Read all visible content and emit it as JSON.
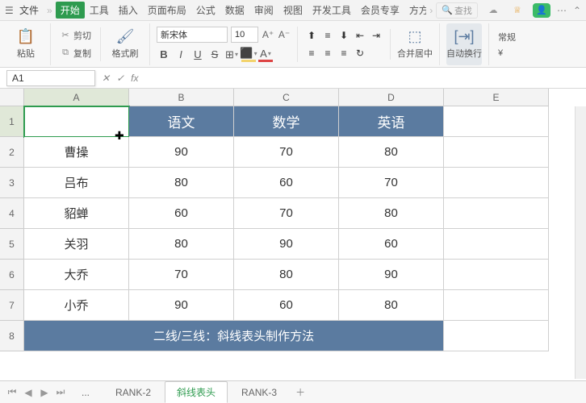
{
  "titlebar": {
    "file": "文件",
    "tabs": [
      "开始",
      "工具",
      "插入",
      "页面布局",
      "公式",
      "数据",
      "审阅",
      "视图",
      "开发工具",
      "会员专享",
      "方方格子"
    ],
    "search_placeholder": "查找"
  },
  "ribbon": {
    "paste": "粘贴",
    "cut": "剪切",
    "copy": "复制",
    "format_painter": "格式刷",
    "font_name": "新宋体",
    "font_size": "10",
    "merge": "合并居中",
    "wrap": "自动换行",
    "format": "常规"
  },
  "namebox": "A1",
  "columns": [
    "A",
    "B",
    "C",
    "D",
    "E"
  ],
  "rows": [
    "1",
    "2",
    "3",
    "4",
    "5",
    "6",
    "7",
    "8"
  ],
  "chart_data": {
    "type": "table",
    "header": [
      "",
      "语文",
      "数学",
      "英语"
    ],
    "body": [
      [
        "曹操",
        "90",
        "70",
        "80"
      ],
      [
        "吕布",
        "80",
        "60",
        "70"
      ],
      [
        "貂蝉",
        "60",
        "70",
        "80"
      ],
      [
        "关羽",
        "80",
        "90",
        "60"
      ],
      [
        "大乔",
        "70",
        "80",
        "90"
      ],
      [
        "小乔",
        "90",
        "60",
        "80"
      ]
    ],
    "footer": "二线/三线：斜线表头制作方法"
  },
  "sheets": {
    "items": [
      "...",
      "RANK-2",
      "斜线表头",
      "RANK-3"
    ],
    "active": 2
  }
}
